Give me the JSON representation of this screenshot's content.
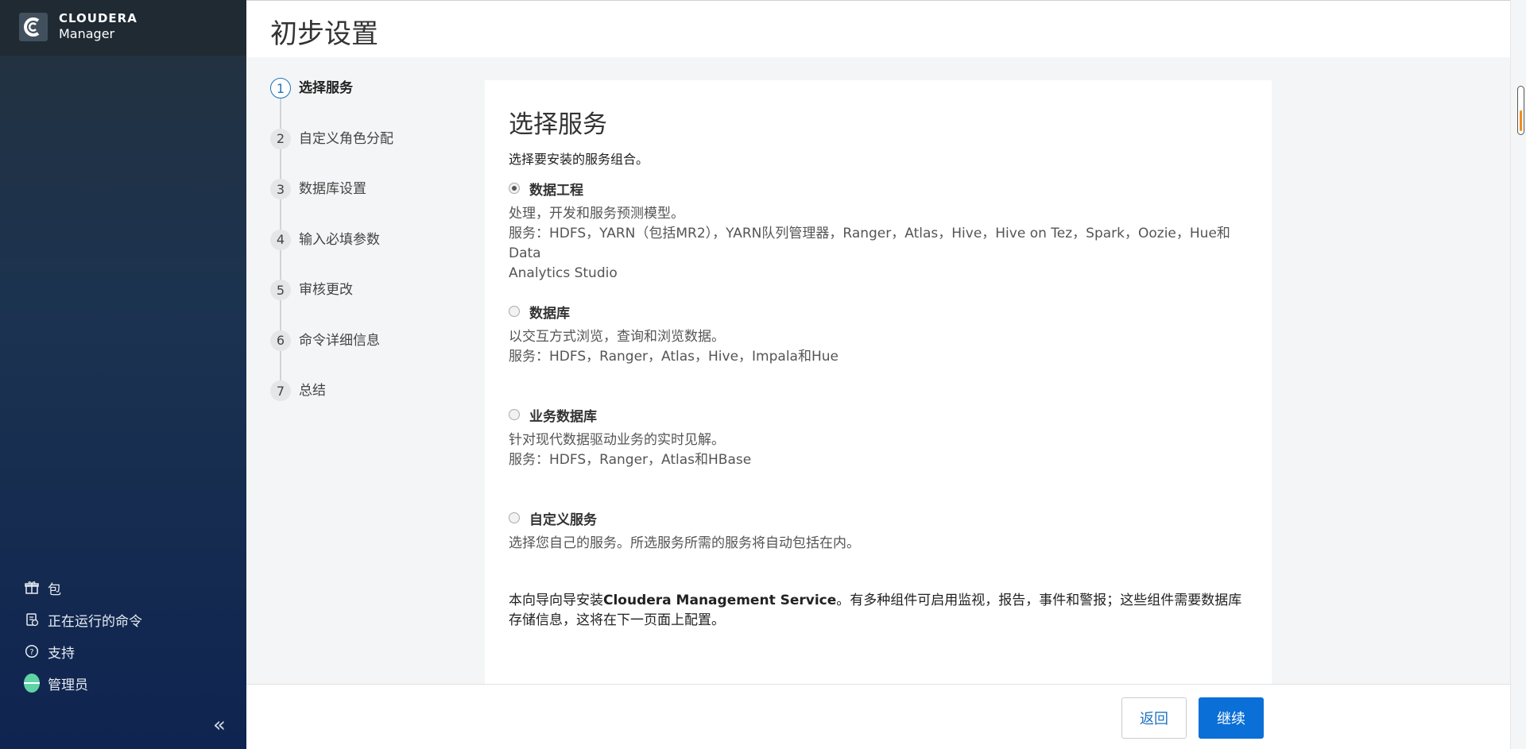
{
  "brand": {
    "name": "CLOUDERA",
    "product": "Manager"
  },
  "sidebar": {
    "items": [
      {
        "label": "包",
        "icon": "package-icon"
      },
      {
        "label": "正在运行的命令",
        "icon": "running-commands-icon"
      },
      {
        "label": "支持",
        "icon": "help-circle-icon"
      },
      {
        "label": "管理员",
        "icon": "user-avatar"
      }
    ],
    "collapse_glyph": "«"
  },
  "page": {
    "title": "初步设置"
  },
  "steps": [
    {
      "num": "1",
      "label": "选择服务",
      "active": true
    },
    {
      "num": "2",
      "label": "自定义角色分配"
    },
    {
      "num": "3",
      "label": "数据库设置"
    },
    {
      "num": "4",
      "label": "输入必填参数"
    },
    {
      "num": "5",
      "label": "审核更改"
    },
    {
      "num": "6",
      "label": "命令详细信息"
    },
    {
      "num": "7",
      "label": "总结"
    }
  ],
  "panel": {
    "title": "选择服务",
    "description": "选择要安装的服务组合。",
    "options": [
      {
        "title": "数据工程",
        "checked": true,
        "desc": "处理，开发和服务预测模型。",
        "services": "服务：HDFS，YARN（包括MR2），YARN队列管理器，Ranger，Atlas，Hive，Hive on Tez，Spark，Oozie，Hue和Data",
        "services_cont": "Analytics Studio"
      },
      {
        "title": "数据库",
        "checked": false,
        "desc": "以交互方式浏览，查询和浏览数据。",
        "services": "服务：HDFS，Ranger，Atlas，Hive，Impala和Hue"
      },
      {
        "title": "业务数据库",
        "checked": false,
        "desc": "针对现代数据驱动业务的实时见解。",
        "services": "服务：HDFS，Ranger，Atlas和HBase"
      },
      {
        "title": "自定义服务",
        "checked": false,
        "desc": "选择您自己的服务。所选服务所需的服务将自动包括在内。"
      }
    ],
    "note_prefix": "本向导向导安装",
    "note_bold": "Cloudera Management Service",
    "note_suffix": "。有多种组件可启用监视，报告，事件和警报；这些组件需要数据库存储信息，这将在下一页面上配置。"
  },
  "footer": {
    "back_label": "返回",
    "next_label": "继续"
  },
  "colors": {
    "accent": "#0a6fd6",
    "sidebar_top": "#23313d",
    "sidebar_bottom": "#0f2450",
    "scroll_mark": "#f28c1c"
  }
}
